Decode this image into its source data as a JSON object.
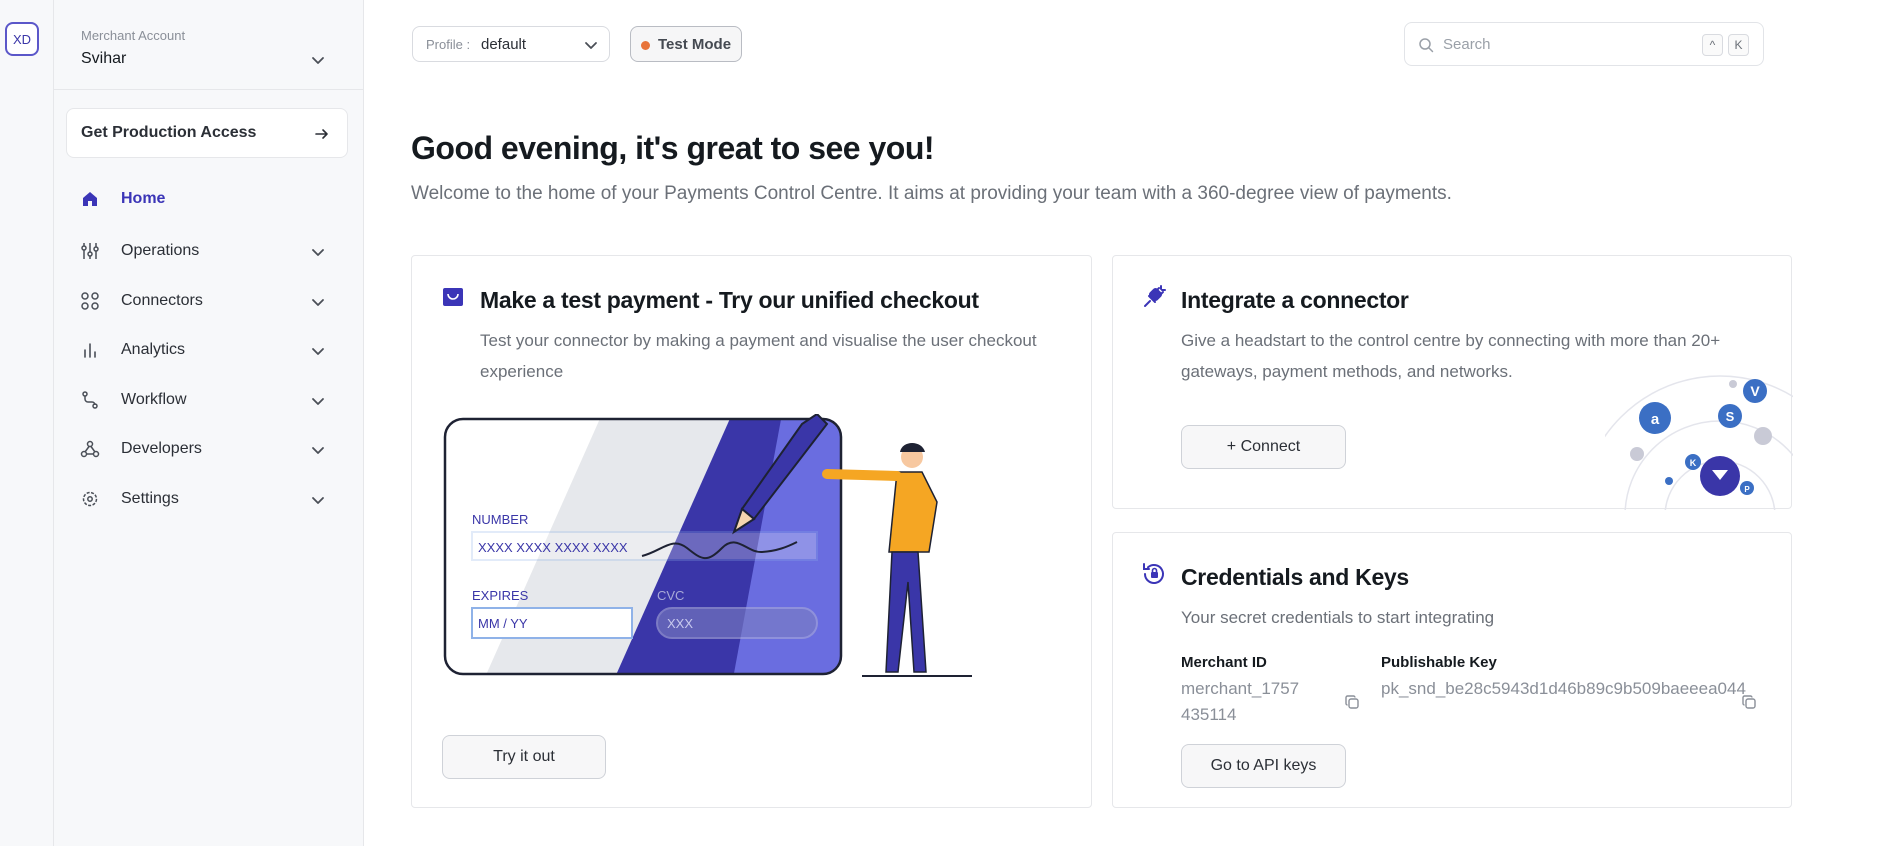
{
  "rail": {
    "avatar": "XD"
  },
  "sidebar": {
    "account_label": "Merchant Account",
    "account_name": "Svihar",
    "production_button": "Get Production Access",
    "items": [
      {
        "label": "Home",
        "icon": "home-icon"
      },
      {
        "label": "Operations",
        "icon": "operations-icon"
      },
      {
        "label": "Connectors",
        "icon": "connectors-icon"
      },
      {
        "label": "Analytics",
        "icon": "analytics-icon"
      },
      {
        "label": "Workflow",
        "icon": "workflow-icon"
      },
      {
        "label": "Developers",
        "icon": "developers-icon"
      },
      {
        "label": "Settings",
        "icon": "settings-icon"
      }
    ]
  },
  "topbar": {
    "profile_label": "Profile :",
    "profile_value": "default",
    "test_mode": "Test Mode",
    "search_placeholder": "Search",
    "shortcut_keys": [
      "^",
      "K"
    ]
  },
  "hero": {
    "greeting": "Good evening, it's great to see you!",
    "subtitle": "Welcome to the home of your Payments Control Centre. It aims at providing your team with a 360-degree view of payments."
  },
  "test_payment": {
    "title": "Make a test payment - Try our unified checkout",
    "description": "Test your connector by making a payment and visualise the user checkout experience",
    "card_number_label": "NUMBER",
    "card_number_value": "XXXX XXXX XXXX XXXX",
    "expires_label": "EXPIRES",
    "expires_value": "MM / YY",
    "cvc_label": "CVC",
    "cvc_value": "XXX",
    "button": "Try it out"
  },
  "connector": {
    "title": "Integrate a connector",
    "description": "Give a headstart to the control centre by connecting with more than 20+ gateways, payment methods, and networks.",
    "button": "+  Connect",
    "badges": [
      "V",
      "S",
      "a",
      "K",
      "P"
    ]
  },
  "credentials": {
    "title": "Credentials and Keys",
    "description": "Your secret credentials to start integrating",
    "merchant_id_label": "Merchant ID",
    "merchant_id_value": "merchant_1757435114",
    "publishable_key_label": "Publishable Key",
    "publishable_key_value": "pk_snd_be28c5943d1d46b89c9b509baeeea044",
    "button": "Go to API keys"
  },
  "colors": {
    "accent": "#3b35b7",
    "test_mode_dot": "#e8743a",
    "illustration_dark": "#3a36a8",
    "illustration_light": "#6a6de0",
    "person_shirt": "#f5a623"
  }
}
